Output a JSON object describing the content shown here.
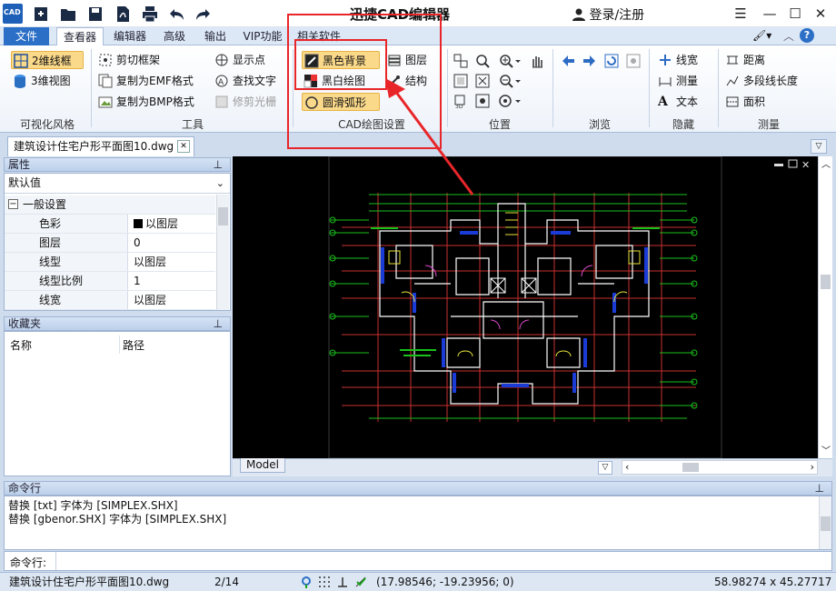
{
  "app": {
    "title": "迅捷CAD编辑器",
    "login": "登录/注册",
    "logo_text": "CAD"
  },
  "tabs": [
    {
      "label": "文件"
    },
    {
      "label": "查看器"
    },
    {
      "label": "编辑器"
    },
    {
      "label": "高级"
    },
    {
      "label": "输出"
    },
    {
      "label": "VIP功能"
    },
    {
      "label": "相关软件"
    }
  ],
  "ribbon": {
    "visual_style": {
      "label": "可视化风格",
      "items": [
        "2维线框",
        "3维视图"
      ]
    },
    "tools": {
      "label": "工具",
      "items": [
        "剪切框架",
        "复制为EMF格式",
        "复制为BMP格式",
        "显示点",
        "查找文字",
        "修剪光栅"
      ]
    },
    "cad_settings": {
      "label": "CAD绘图设置",
      "items": [
        "黑色背景",
        "黑白绘图",
        "圆滑弧形",
        "图层",
        "结构"
      ]
    },
    "position": {
      "label": "位置"
    },
    "browse": {
      "label": "浏览"
    },
    "hide": {
      "label": "隐藏",
      "items": [
        "线宽",
        "测量",
        "文本"
      ]
    },
    "measure": {
      "label": "测量",
      "items": [
        "距离",
        "多段线长度",
        "面积"
      ]
    }
  },
  "document_tab": {
    "name": "建筑设计住宅户形平面图10.dwg"
  },
  "properties": {
    "header": "属性",
    "selector": "默认值",
    "section": "一般设置",
    "rows": [
      {
        "key": "色彩",
        "value": "以图层"
      },
      {
        "key": "图层",
        "value": "0"
      },
      {
        "key": "线型",
        "value": "以图层"
      },
      {
        "key": "线型比例",
        "value": "1"
      },
      {
        "key": "线宽",
        "value": "以图层"
      }
    ]
  },
  "favorites": {
    "header": "收藏夹",
    "col_name": "名称",
    "col_path": "路径"
  },
  "drawing": {
    "model_tab": "Model"
  },
  "command": {
    "header": "命令行",
    "lines": [
      "替换 [txt] 字体为 [SIMPLEX.SHX]",
      "替换 [gbenor.SHX] 字体为 [SIMPLEX.SHX]"
    ],
    "prompt": "命令行:"
  },
  "status": {
    "file": "建筑设计住宅户形平面图10.dwg",
    "page": "2/14",
    "coords": "(17.98546; -19.23956; 0)",
    "size": "58.98274 x 45.27717 x 0"
  },
  "colors": {
    "accent": "#2b6fc6",
    "selected": "#fbd98a",
    "annotation": "#e8262a",
    "cad_green": "#19c11b",
    "cad_red": "#d42a2a",
    "cad_blue": "#1b3bd6"
  }
}
